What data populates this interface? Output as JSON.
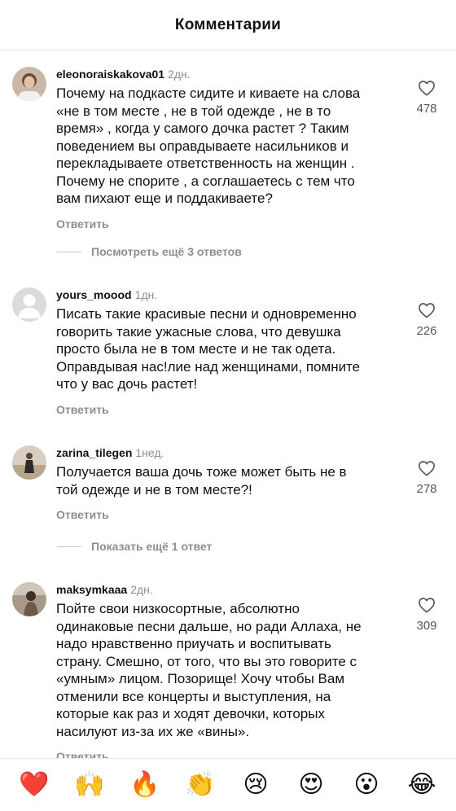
{
  "header": {
    "title": "Комментарии"
  },
  "comments": [
    {
      "username": "eleonoraiskakova01",
      "time": "2дн.",
      "text": "Почему на подкасте сидите и киваете на слова\n«не в том месте , не в той одежде , не в то\nвремя» , когда у самого дочка растет ? Таким\nповедением вы оправдываете насильников и\nперекладываете ответственность на женщин .\nПочему не спорите , а соглашаетесь с тем что\nвам пихают еще и поддакиваете?",
      "reply_label": "Ответить",
      "likes": "478"
    },
    {
      "username": "yours_moood",
      "time": "1дн.",
      "text": "Писать такие красивые песни и одновременно\nговорить такие ужасные слова, что девушка\nпросто была не в том месте и не так одета.\nОправдывая нас!лие над женщинами, помните\nчто у вас дочь растет!",
      "reply_label": "Ответить",
      "likes": "226"
    },
    {
      "username": "zarina_tilegen",
      "time": "1нед.",
      "text": "Получается ваша дочь тоже может быть не в\nтой одежде и не в том месте?!",
      "reply_label": "Ответить",
      "likes": "278"
    },
    {
      "username": "maksymkaaa",
      "time": "2дн.",
      "text": "Пойте свои низкосортные, абсолютно\nодинаковые песни дальше, но ради Аллаха, не\nнадо нравственно приучать и воспитывать\nстрану. Смешно, от того, что вы это говорите с\n«умным» лицом. Позорище! Хочу чтобы Вам\nотменили все концерты и выступления, на\nкоторые как раз и ходят девочки, которых\nнасилуют из-за их же «вины».",
      "reply_label": "Ответить",
      "likes": "309"
    }
  ],
  "more_replies": [
    {
      "label": "Посмотреть ещё 3 ответов"
    },
    {
      "label": "Показать ещё 1 ответ"
    }
  ],
  "emoji_bar": {
    "items": [
      "❤️",
      "🙌",
      "🔥",
      "👏",
      "😢",
      "😍",
      "😮",
      "😂"
    ]
  },
  "colors": {
    "text": "#111111",
    "muted": "#8e8e8e",
    "divider": "#e3e3e3"
  }
}
